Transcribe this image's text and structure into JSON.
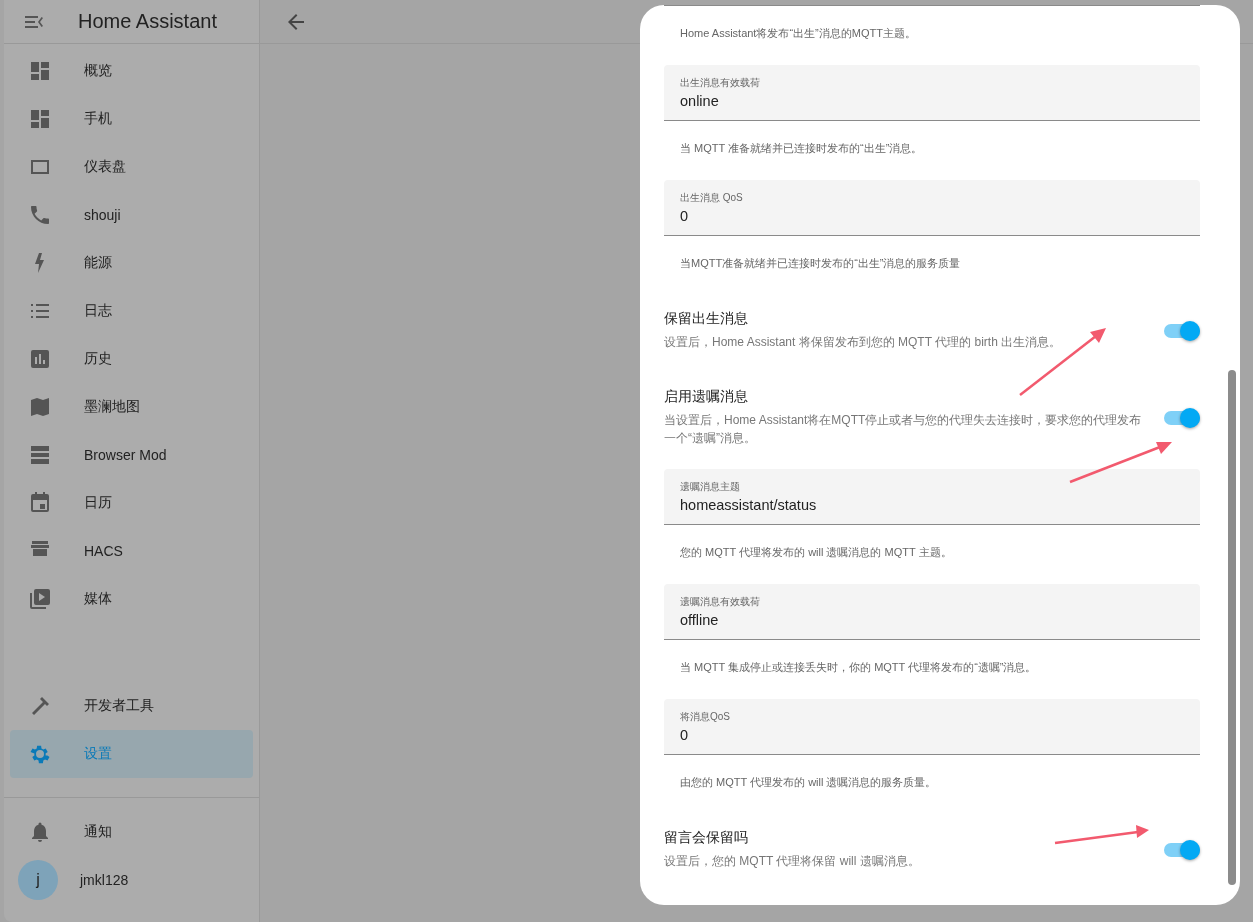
{
  "sidebar": {
    "title": "Home Assistant",
    "items": [
      {
        "label": "概览",
        "selected": false
      },
      {
        "label": "手机",
        "selected": false
      },
      {
        "label": "仪表盘",
        "selected": false
      },
      {
        "label": "shouji",
        "selected": false
      },
      {
        "label": "能源",
        "selected": false
      },
      {
        "label": "日志",
        "selected": false
      },
      {
        "label": "历史",
        "selected": false
      },
      {
        "label": "墨澜地图",
        "selected": false
      },
      {
        "label": "Browser Mod",
        "selected": false
      },
      {
        "label": "日历",
        "selected": false
      },
      {
        "label": "HACS",
        "selected": false
      },
      {
        "label": "媒体",
        "selected": false
      }
    ],
    "tools": [
      {
        "label": "开发者工具",
        "selected": false
      },
      {
        "label": "设置",
        "selected": true
      }
    ],
    "notifications": "通知",
    "user": {
      "initial": "j",
      "name": "jmkl128"
    }
  },
  "dialog": {
    "rows": [
      {
        "kind": "helper",
        "helper": "Home Assistant将发布“出生”消息的MQTT主题。"
      },
      {
        "kind": "field",
        "label": "出生消息有效载荷",
        "value": "online",
        "helper": "当 MQTT 准备就绪并已连接时发布的“出生”消息。"
      },
      {
        "kind": "field",
        "label": "出生消息 QoS",
        "value": "0",
        "helper": "当MQTT准备就绪并已连接时发布的“出生”消息的服务质量"
      },
      {
        "kind": "switch",
        "title": "保留出生消息",
        "description": "设置后，Home Assistant 将保留发布到您的 MQTT 代理的 birth 出生消息。",
        "on": true
      },
      {
        "kind": "switch",
        "title": "启用遗嘱消息",
        "description": "当设置后，Home Assistant将在MQTT停止或者与您的代理失去连接时，要求您的代理发布一个“遗嘱”消息。",
        "on": true
      },
      {
        "kind": "field",
        "label": "遗嘱消息主题",
        "value": "homeassistant/status",
        "helper": "您的 MQTT 代理将发布的 will 遗嘱消息的 MQTT 主题。"
      },
      {
        "kind": "field",
        "label": "遗嘱消息有效载荷",
        "value": "offline",
        "helper": "当 MQTT 集成停止或连接丢失时，你的 MQTT 代理将发布的“遗嘱”消息。"
      },
      {
        "kind": "field",
        "label": "将消息QoS",
        "value": "0",
        "helper": "由您的 MQTT 代理发布的 will 遗嘱消息的服务质量。"
      },
      {
        "kind": "switch",
        "title": "留言会保留吗",
        "description": "设置后，您的 MQTT 代理将保留 will 遗嘱消息。",
        "on": true
      }
    ]
  }
}
